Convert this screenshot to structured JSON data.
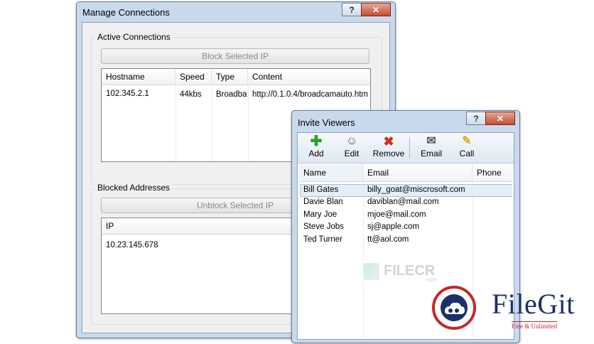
{
  "manage": {
    "title": "Manage Connections",
    "help_btn": "?",
    "close_btn": "✕",
    "active": {
      "label": "Active Connections",
      "block_btn": "Block Selected IP",
      "columns": [
        "Hostname",
        "Speed",
        "Type",
        "Content"
      ],
      "rows": [
        [
          "102.345.2.1",
          "44kbs",
          "Broadba",
          "http://0.1.0.4/broadcamauto.htm"
        ]
      ]
    },
    "blocked": {
      "label": "Blocked Addresses",
      "unblock_btn": "Unblock Selected IP",
      "columns": [
        "IP"
      ],
      "rows": [
        "10.23.145.678"
      ]
    }
  },
  "invite": {
    "title": "Invite Viewers",
    "help_btn": "?",
    "close_btn": "✕",
    "toolbar": [
      {
        "label": "Add",
        "icon": "plus-icon"
      },
      {
        "label": "Edit",
        "icon": "edit-user-icon"
      },
      {
        "label": "Remove",
        "icon": "remove-x-icon"
      },
      {
        "label": "Email",
        "icon": "email-icon"
      },
      {
        "label": "Call",
        "icon": "phone-icon"
      }
    ],
    "columns": [
      "Name",
      "Email",
      "Phone"
    ],
    "rows": [
      [
        "Bill Gates",
        "billy_goat@miscrosoft.com",
        ""
      ],
      [
        "Davie Blan",
        "daviblan@mail.com",
        ""
      ],
      [
        "Mary Joe",
        "mjoe@mail.com",
        ""
      ],
      [
        "Steve Jobs",
        "sj@apple.com",
        ""
      ],
      [
        "Ted Turner",
        "tt@aol.com",
        ""
      ]
    ]
  },
  "watermarks": {
    "filecr": "FILECR",
    "filecr_sub": ".com",
    "filegit": "FileGit",
    "filegit_tag": "Free & Unlimited"
  },
  "colors": {
    "window_frame": "#c9d9ec",
    "selected_row": "#e3eef9",
    "add_green": "#2aa12a",
    "remove_red": "#d12d1d",
    "call_yellow": "#e0b020",
    "filegit_blue": "#1b2f6b",
    "filegit_red": "#c62828"
  }
}
